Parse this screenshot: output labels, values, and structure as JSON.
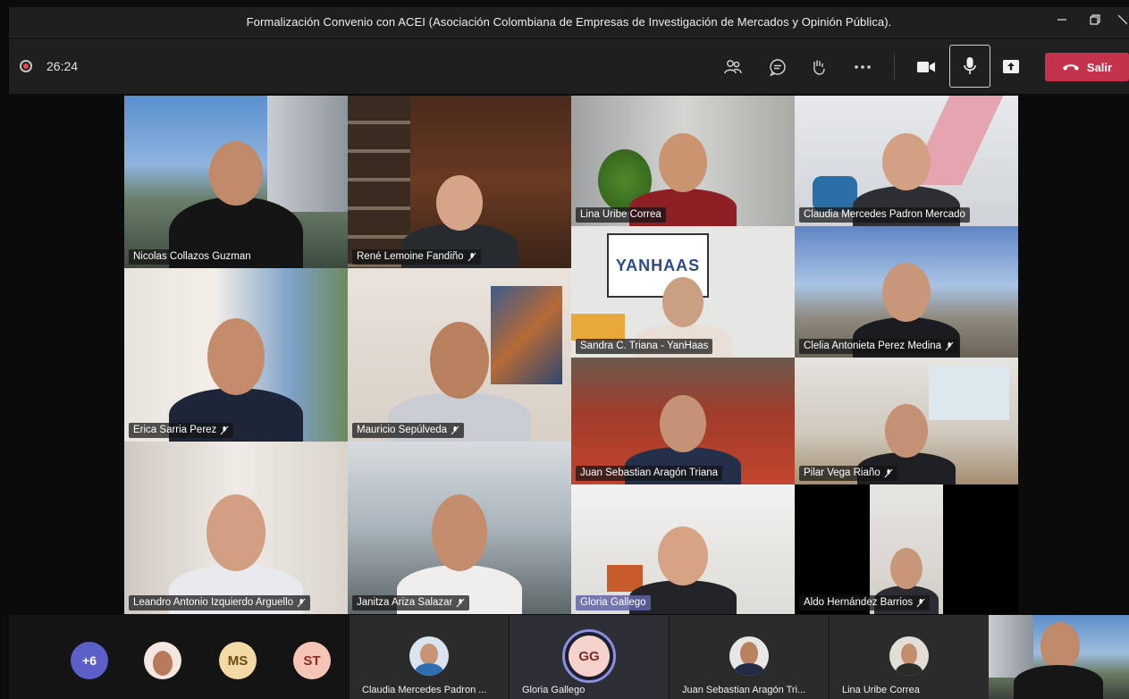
{
  "window": {
    "title": "Formalización Convenio con ACEI (Asociación Colombiana de Empresas de Investigación de Mercados y Opinión Pública).",
    "minimize_icon": "minimize-icon",
    "restore_icon": "restore-icon",
    "close_icon": "close-icon"
  },
  "toolbar": {
    "timer": "26:24",
    "recording_color": "#e5484d",
    "leave_label": "Salir",
    "leave_color": "#c4314b",
    "icons": [
      "participants-icon",
      "chat-icon",
      "raise-hand-icon",
      "more-icon",
      "camera-icon",
      "mic-icon",
      "share-icon",
      "hangup-icon"
    ]
  },
  "tiles": [
    {
      "name": "Nicolas Collazos Guzman",
      "muted": false
    },
    {
      "name": "René Lemoine Fandiño",
      "muted": true
    },
    {
      "name": "Lina Uribe Correa",
      "muted": false
    },
    {
      "name": "Claudia Mercedes Padron Mercado",
      "muted": false
    },
    {
      "name": "Sandra C. Triana - YanHaas",
      "muted": false
    },
    {
      "name": "Clelia Antonieta Perez Medina",
      "muted": true
    },
    {
      "name": "Erica Sarria Perez",
      "muted": true
    },
    {
      "name": "Mauricio Sepúlveda",
      "muted": true
    },
    {
      "name": "Juan Sebastian Aragón Triana",
      "muted": false
    },
    {
      "name": "Pilar Vega Riaño",
      "muted": true
    },
    {
      "name": "Leandro Antonio Izquierdo Arguello",
      "muted": true
    },
    {
      "name": "Janitza Ariza Salazar",
      "muted": true
    },
    {
      "name": "Gloria Gallego",
      "muted": false
    },
    {
      "name": "Aldo Hernández Barrios",
      "muted": true
    }
  ],
  "yanhaas_sign": "YANHAAS",
  "strip": {
    "overflow": "+6",
    "initials_ms": "MS",
    "initials_st": "ST",
    "initials_gg": "GG",
    "cards": [
      {
        "label": "Claudia Mercedes Padron ..."
      },
      {
        "label": "Gloria Gallego"
      },
      {
        "label": "Juan Sebastian Aragón Tri..."
      },
      {
        "label": "Lina Uribe Correa"
      }
    ]
  }
}
